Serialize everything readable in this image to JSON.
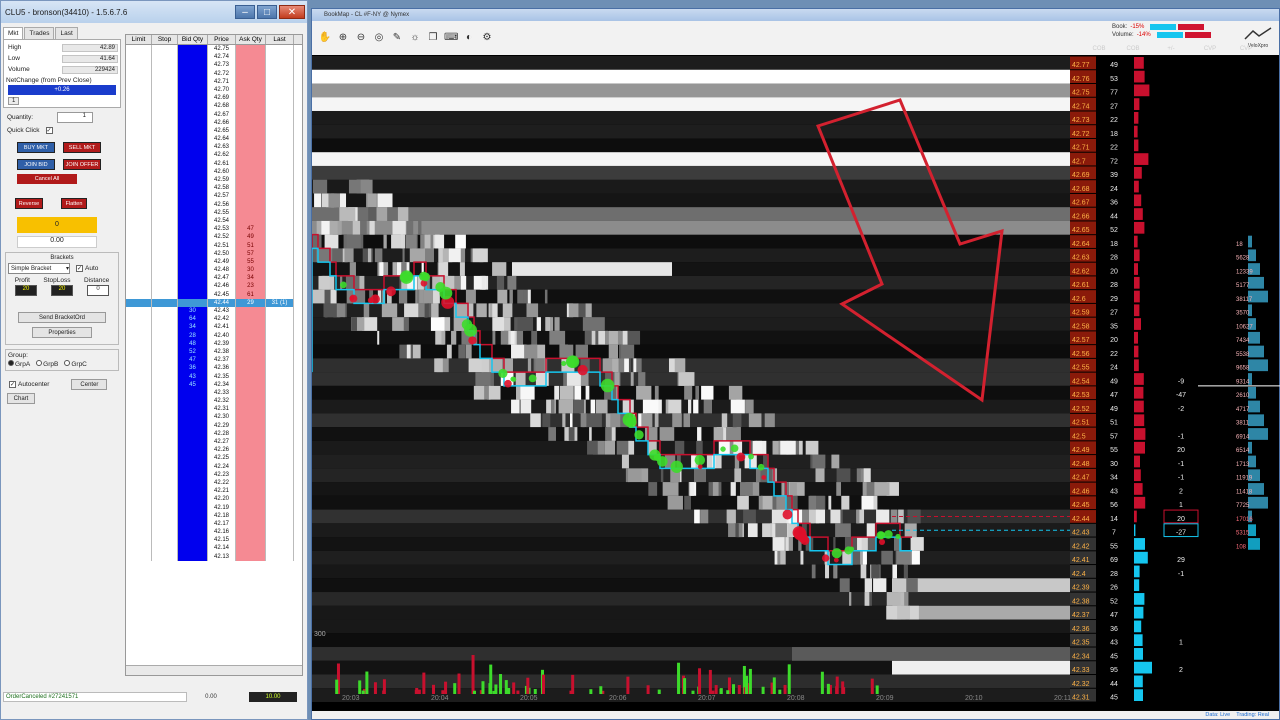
{
  "left_window": {
    "title": "CLU5 - bronson(34410) - 1.5.6.7.6",
    "tabs": [
      "Mkt",
      "Trades",
      "Last"
    ],
    "stats": [
      {
        "label": "High",
        "value": "42.89"
      },
      {
        "label": "Low",
        "value": "41.64"
      },
      {
        "label": "Volume",
        "value": "229424"
      }
    ],
    "net_change_label": "NetChange (from Prev Close)",
    "net_change_value": "+0.26",
    "small_button": "1",
    "quantity_label": "Quantity:",
    "quantity_value": "1",
    "quick_click_label": "Quick Click",
    "buttons": {
      "buy_mkt": "BUY MKT",
      "sell_mkt": "SELL MKT",
      "join_bid": "JOIN BID",
      "join_offer": "JOIN OFFER",
      "cancel_all": "Cancel All",
      "reverse": "Reverse",
      "flatten": "Flatten"
    },
    "position": "0",
    "pnl": "0.00",
    "brackets_title": "Brackets",
    "bracket_type": "Simple Bracket",
    "auto_label": "Auto",
    "bracket_cols": [
      "Profit",
      "StopLoss",
      "Distance"
    ],
    "bracket_values": [
      "20",
      "20",
      "0"
    ],
    "send_bracket": "Send BracketOrd",
    "properties": "Properties",
    "group_label": "Group:",
    "groups": [
      "GrpA",
      "GrpB",
      "GrpC"
    ],
    "autocenter_label": "Autocenter",
    "center_btn": "Center",
    "chart_btn": "Chart",
    "status_msg": "OrderCanceled #27241571",
    "status_pnl1": "0.00",
    "status_pnl2": "10.00"
  },
  "ladder": {
    "headers": [
      "Limit",
      "Stop",
      "Bid Qty",
      "Price",
      "Ask Qty",
      "Last"
    ],
    "current_price": "42.44",
    "rows": [
      {
        "p": "42.75",
        "a": "",
        "b": ""
      },
      {
        "p": "42.74",
        "a": "",
        "b": ""
      },
      {
        "p": "42.73",
        "a": "",
        "b": ""
      },
      {
        "p": "42.72",
        "a": "",
        "b": ""
      },
      {
        "p": "42.71",
        "a": "",
        "b": ""
      },
      {
        "p": "42.70",
        "a": "",
        "b": ""
      },
      {
        "p": "42.69",
        "a": "",
        "b": ""
      },
      {
        "p": "42.68",
        "a": "",
        "b": ""
      },
      {
        "p": "42.67",
        "a": "",
        "b": ""
      },
      {
        "p": "42.66",
        "a": "",
        "b": ""
      },
      {
        "p": "42.65",
        "a": "",
        "b": ""
      },
      {
        "p": "42.64",
        "a": "",
        "b": ""
      },
      {
        "p": "42.63",
        "a": "",
        "b": ""
      },
      {
        "p": "42.62",
        "a": "",
        "b": ""
      },
      {
        "p": "42.61",
        "a": "",
        "b": ""
      },
      {
        "p": "42.60",
        "a": "",
        "b": ""
      },
      {
        "p": "42.59",
        "a": "",
        "b": ""
      },
      {
        "p": "42.58",
        "a": "",
        "b": ""
      },
      {
        "p": "42.57",
        "a": "",
        "b": ""
      },
      {
        "p": "42.56",
        "a": "",
        "b": ""
      },
      {
        "p": "42.55",
        "a": "",
        "b": ""
      },
      {
        "p": "42.54",
        "a": "",
        "b": ""
      },
      {
        "p": "42.53",
        "a": "47",
        "b": ""
      },
      {
        "p": "42.52",
        "a": "49",
        "b": ""
      },
      {
        "p": "42.51",
        "a": "51",
        "b": ""
      },
      {
        "p": "42.50",
        "a": "57",
        "b": ""
      },
      {
        "p": "42.49",
        "a": "55",
        "b": ""
      },
      {
        "p": "42.48",
        "a": "30",
        "b": ""
      },
      {
        "p": "42.47",
        "a": "34",
        "b": ""
      },
      {
        "p": "42.46",
        "a": "23",
        "b": ""
      },
      {
        "p": "42.45",
        "a": "61",
        "b": ""
      },
      {
        "p": "42.44",
        "a": "29",
        "b": "",
        "last": "31 (1)"
      },
      {
        "p": "42.43",
        "a": "",
        "b": "30"
      },
      {
        "p": "42.42",
        "a": "",
        "b": "64"
      },
      {
        "p": "42.41",
        "a": "",
        "b": "34"
      },
      {
        "p": "42.40",
        "a": "",
        "b": "28"
      },
      {
        "p": "42.39",
        "a": "",
        "b": "48"
      },
      {
        "p": "42.38",
        "a": "",
        "b": "52"
      },
      {
        "p": "42.37",
        "a": "",
        "b": "47"
      },
      {
        "p": "42.36",
        "a": "",
        "b": "36"
      },
      {
        "p": "42.35",
        "a": "",
        "b": "43"
      },
      {
        "p": "42.34",
        "a": "",
        "b": "45"
      },
      {
        "p": "42.33",
        "a": "",
        "b": ""
      },
      {
        "p": "42.32",
        "a": "",
        "b": ""
      },
      {
        "p": "42.31",
        "a": "",
        "b": ""
      },
      {
        "p": "42.30",
        "a": "",
        "b": ""
      },
      {
        "p": "42.29",
        "a": "",
        "b": ""
      },
      {
        "p": "42.28",
        "a": "",
        "b": ""
      },
      {
        "p": "42.27",
        "a": "",
        "b": ""
      },
      {
        "p": "42.26",
        "a": "",
        "b": ""
      },
      {
        "p": "42.25",
        "a": "",
        "b": ""
      },
      {
        "p": "42.24",
        "a": "",
        "b": ""
      },
      {
        "p": "42.23",
        "a": "",
        "b": ""
      },
      {
        "p": "42.22",
        "a": "",
        "b": ""
      },
      {
        "p": "42.21",
        "a": "",
        "b": ""
      },
      {
        "p": "42.20",
        "a": "",
        "b": ""
      },
      {
        "p": "42.19",
        "a": "",
        "b": ""
      },
      {
        "p": "42.18",
        "a": "",
        "b": ""
      },
      {
        "p": "42.17",
        "a": "",
        "b": ""
      },
      {
        "p": "42.16",
        "a": "",
        "b": ""
      },
      {
        "p": "42.15",
        "a": "",
        "b": ""
      },
      {
        "p": "42.14",
        "a": "",
        "b": ""
      },
      {
        "p": "42.13",
        "a": "",
        "b": ""
      }
    ]
  },
  "bookmap": {
    "title": "BookMap - CL #F-NY @ Nymex",
    "legend": [
      {
        "label": "Book:",
        "pct": "-15%"
      },
      {
        "label": "Volume:",
        "pct": "-14%"
      }
    ],
    "vendor": "VeloXpro",
    "col_headers": [
      "COB",
      "COB",
      "+/-",
      "CVP",
      "CVP"
    ],
    "scale_label": "300",
    "time_labels": [
      "20:03",
      "20:04",
      "20:05",
      "20:06",
      "20:07",
      "20:08",
      "20:09",
      "20:10",
      "20:11"
    ],
    "status_left": "Data: Live",
    "status_right": "Trading: Real",
    "colors": {
      "ask": "#c8102e",
      "bid": "#15c6ef",
      "arrow": "#d3212f",
      "buy_dot": "#3ddb2b",
      "sell_dot": "#e0102a"
    },
    "book": [
      {
        "p": "42.77",
        "q": "49",
        "d": ""
      },
      {
        "p": "42.76",
        "q": "53",
        "d": ""
      },
      {
        "p": "42.75",
        "q": "77",
        "d": ""
      },
      {
        "p": "42.74",
        "q": "27",
        "d": ""
      },
      {
        "p": "42.73",
        "q": "22",
        "d": ""
      },
      {
        "p": "42.72",
        "q": "18",
        "d": ""
      },
      {
        "p": "42.71",
        "q": "22",
        "d": ""
      },
      {
        "p": "42.7",
        "q": "72",
        "d": ""
      },
      {
        "p": "42.69",
        "q": "39",
        "d": ""
      },
      {
        "p": "42.68",
        "q": "24",
        "d": ""
      },
      {
        "p": "42.67",
        "q": "36",
        "d": ""
      },
      {
        "p": "42.66",
        "q": "44",
        "d": ""
      },
      {
        "p": "42.65",
        "q": "52",
        "d": ""
      },
      {
        "p": "42.64",
        "q": "18",
        "d": ""
      },
      {
        "p": "42.63",
        "q": "28",
        "d": ""
      },
      {
        "p": "42.62",
        "q": "20",
        "d": ""
      },
      {
        "p": "42.61",
        "q": "28",
        "d": ""
      },
      {
        "p": "42.6",
        "q": "29",
        "d": ""
      },
      {
        "p": "42.59",
        "q": "27",
        "d": ""
      },
      {
        "p": "42.58",
        "q": "35",
        "d": ""
      },
      {
        "p": "42.57",
        "q": "20",
        "d": ""
      },
      {
        "p": "42.56",
        "q": "22",
        "d": ""
      },
      {
        "p": "42.55",
        "q": "24",
        "d": ""
      },
      {
        "p": "42.54",
        "q": "49",
        "d": "-9"
      },
      {
        "p": "42.53",
        "q": "47",
        "d": "-47"
      },
      {
        "p": "42.52",
        "q": "49",
        "d": "-2"
      },
      {
        "p": "42.51",
        "q": "51",
        "d": ""
      },
      {
        "p": "42.5",
        "q": "57",
        "d": "-1"
      },
      {
        "p": "42.49",
        "q": "55",
        "d": "20"
      },
      {
        "p": "42.48",
        "q": "30",
        "d": "-1"
      },
      {
        "p": "42.47",
        "q": "34",
        "d": "-1"
      },
      {
        "p": "42.46",
        "q": "43",
        "d": "2"
      },
      {
        "p": "42.45",
        "q": "56",
        "d": "1"
      },
      {
        "p": "42.44",
        "q": "14",
        "d": "20"
      },
      {
        "p": "42.43",
        "q": "7",
        "d": "-27"
      },
      {
        "p": "42.42",
        "q": "55",
        "d": ""
      },
      {
        "p": "42.41",
        "q": "69",
        "d": "29"
      },
      {
        "p": "42.4",
        "q": "28",
        "d": "-1"
      },
      {
        "p": "42.39",
        "q": "26",
        "d": ""
      },
      {
        "p": "42.38",
        "q": "52",
        "d": ""
      },
      {
        "p": "42.37",
        "q": "47",
        "d": ""
      },
      {
        "p": "42.36",
        "q": "36",
        "d": ""
      },
      {
        "p": "42.35",
        "q": "43",
        "d": "1"
      },
      {
        "p": "42.34",
        "q": "45",
        "d": ""
      },
      {
        "p": "42.33",
        "q": "95",
        "d": "2"
      },
      {
        "p": "42.32",
        "q": "44",
        "d": ""
      },
      {
        "p": "42.31",
        "q": "45",
        "d": ""
      }
    ],
    "cvp": [
      {
        "i": 13,
        "v": "18"
      },
      {
        "i": 14,
        "v": "5628"
      },
      {
        "i": 15,
        "v": "12339"
      },
      {
        "i": 16,
        "v": "5177"
      },
      {
        "i": 17,
        "v": "38117"
      },
      {
        "i": 18,
        "v": "3570"
      },
      {
        "i": 19,
        "v": "10627"
      },
      {
        "i": 20,
        "v": "7434"
      },
      {
        "i": 21,
        "v": "5538"
      },
      {
        "i": 22,
        "v": "9658"
      },
      {
        "i": 23,
        "v": "9314"
      },
      {
        "i": 24,
        "v": "2610"
      },
      {
        "i": 25,
        "v": "4717"
      },
      {
        "i": 26,
        "v": "3811"
      },
      {
        "i": 27,
        "v": "6914"
      },
      {
        "i": 28,
        "v": "6514"
      },
      {
        "i": 29,
        "v": "1713"
      },
      {
        "i": 30,
        "v": "11919"
      },
      {
        "i": 31,
        "v": "11418"
      },
      {
        "i": 32,
        "v": "7725"
      },
      {
        "i": 33,
        "v": "17016"
      },
      {
        "i": 34,
        "v": "5315"
      },
      {
        "i": 35,
        "v": "108"
      }
    ]
  }
}
